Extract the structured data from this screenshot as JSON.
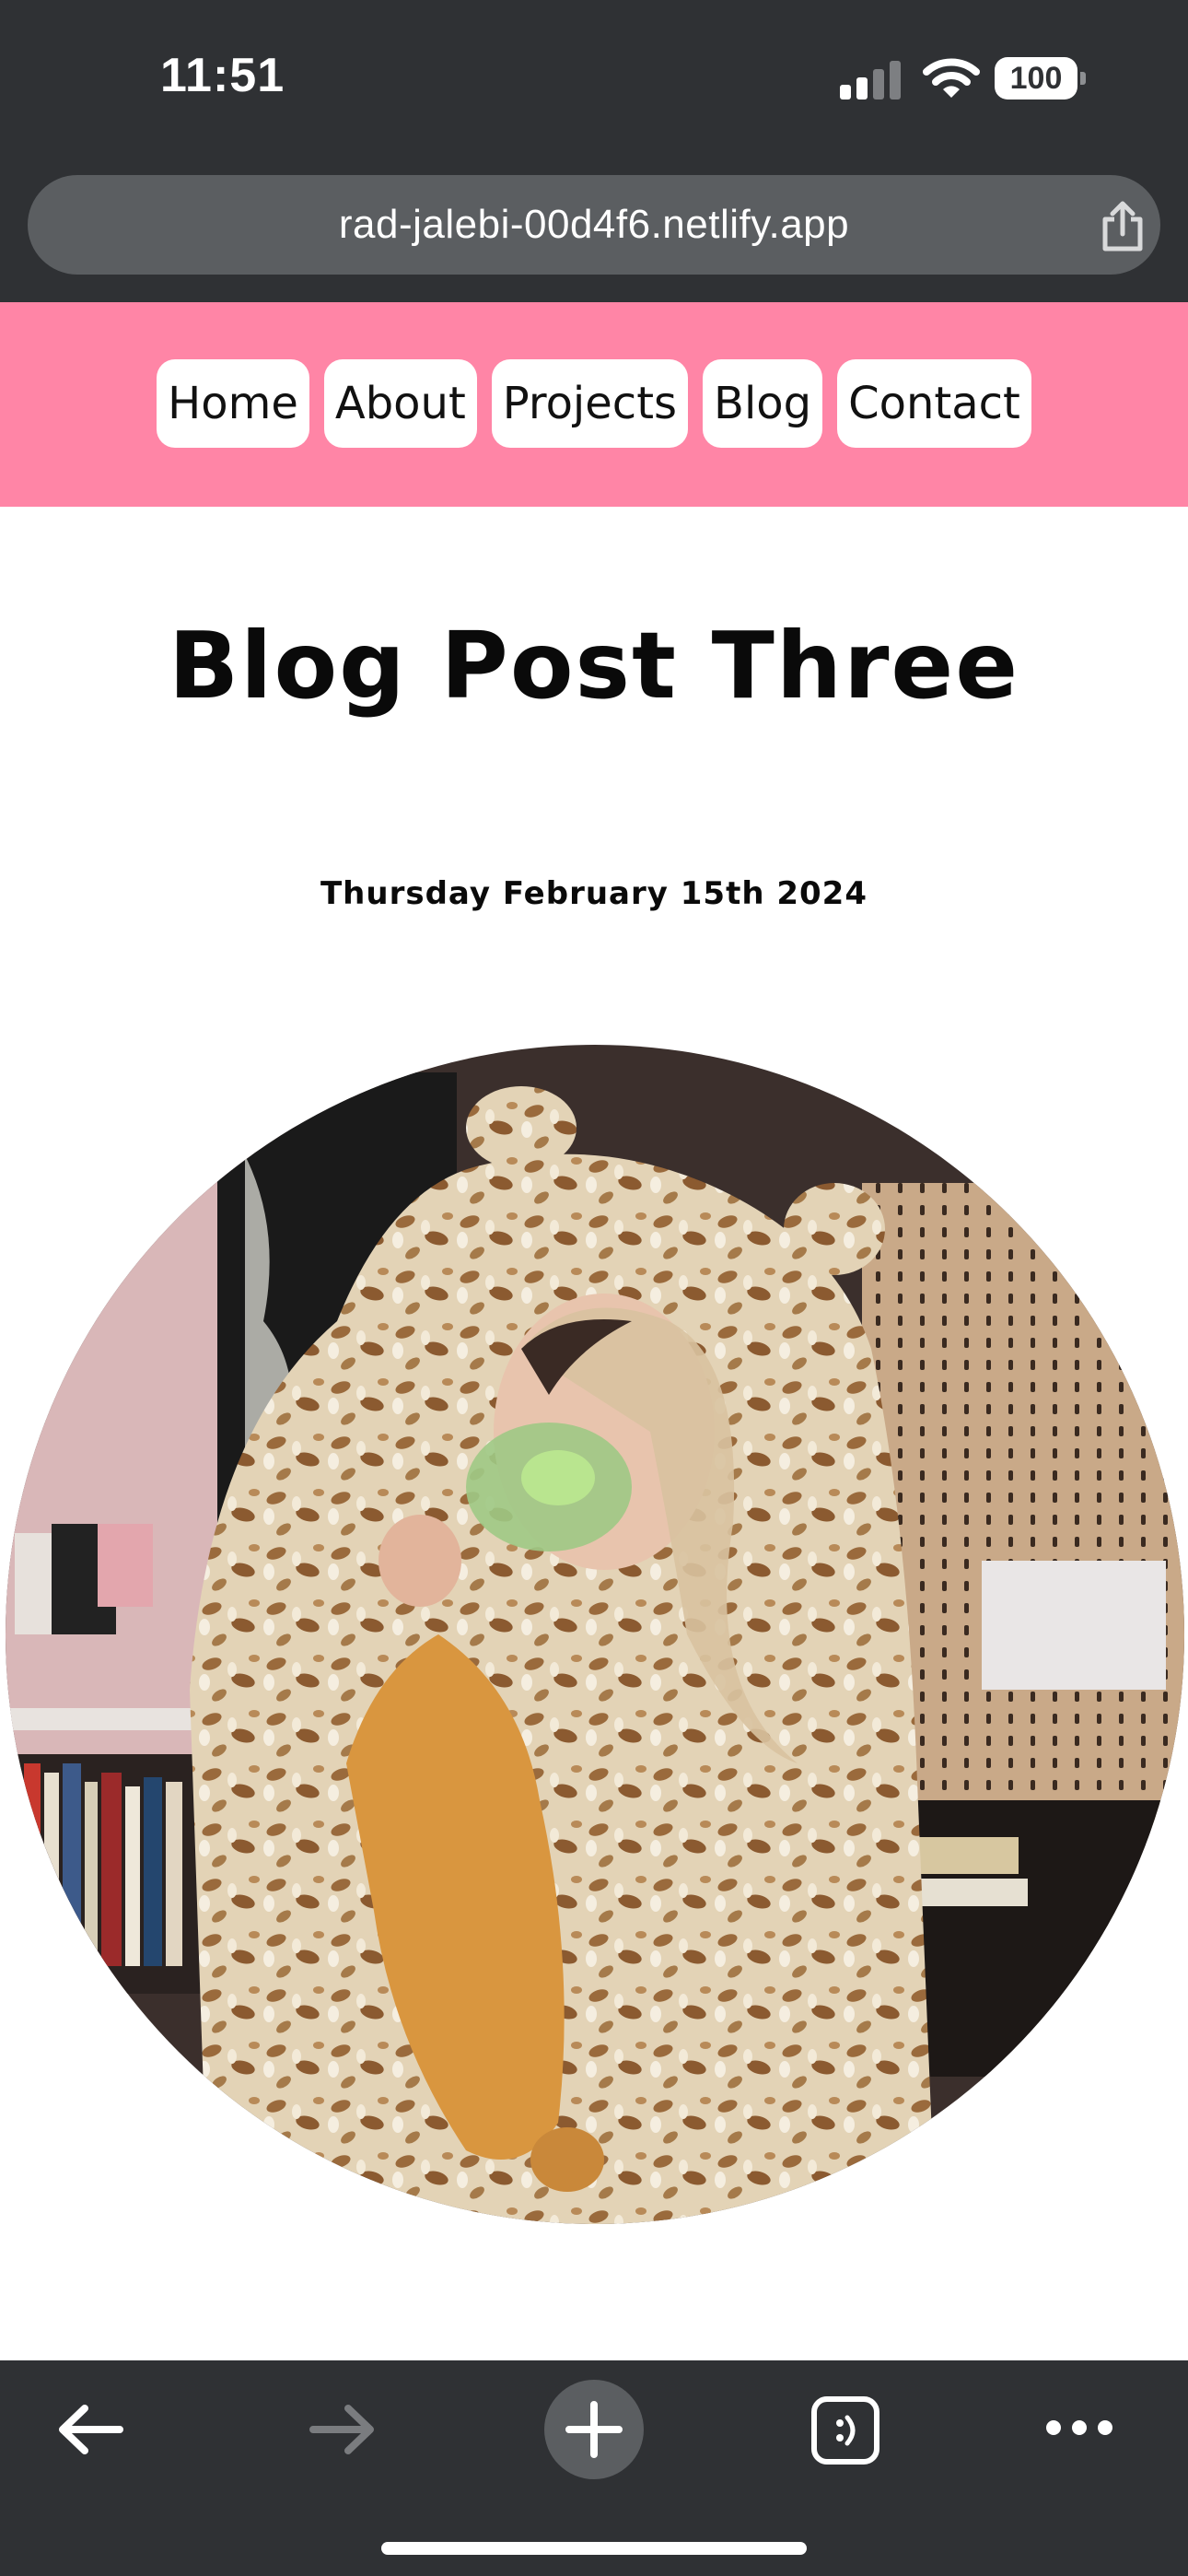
{
  "status_bar": {
    "time": "11:51",
    "battery": "100",
    "icons": [
      "signal-icon",
      "wifi-icon",
      "battery-icon"
    ]
  },
  "browser": {
    "url": "rad-jalebi-00d4f6.netlify.app",
    "share_icon": "share-icon",
    "toolbar_icons": [
      "back-arrow-icon",
      "forward-arrow-icon",
      "new-tab-plus-icon",
      "tabs-icon",
      "more-icon"
    ]
  },
  "nav": {
    "items": [
      "Home",
      "About",
      "Projects",
      "Blog",
      "Contact"
    ]
  },
  "post": {
    "title": "Blog Post Three",
    "date": "Thursday February 15th 2024",
    "image_icon": "blog-post-photo"
  },
  "colors": {
    "chrome": "#2f3134",
    "address_bar": "#5b5e61",
    "nav_band": "#ff85a6",
    "nav_button": "#ffffff"
  }
}
